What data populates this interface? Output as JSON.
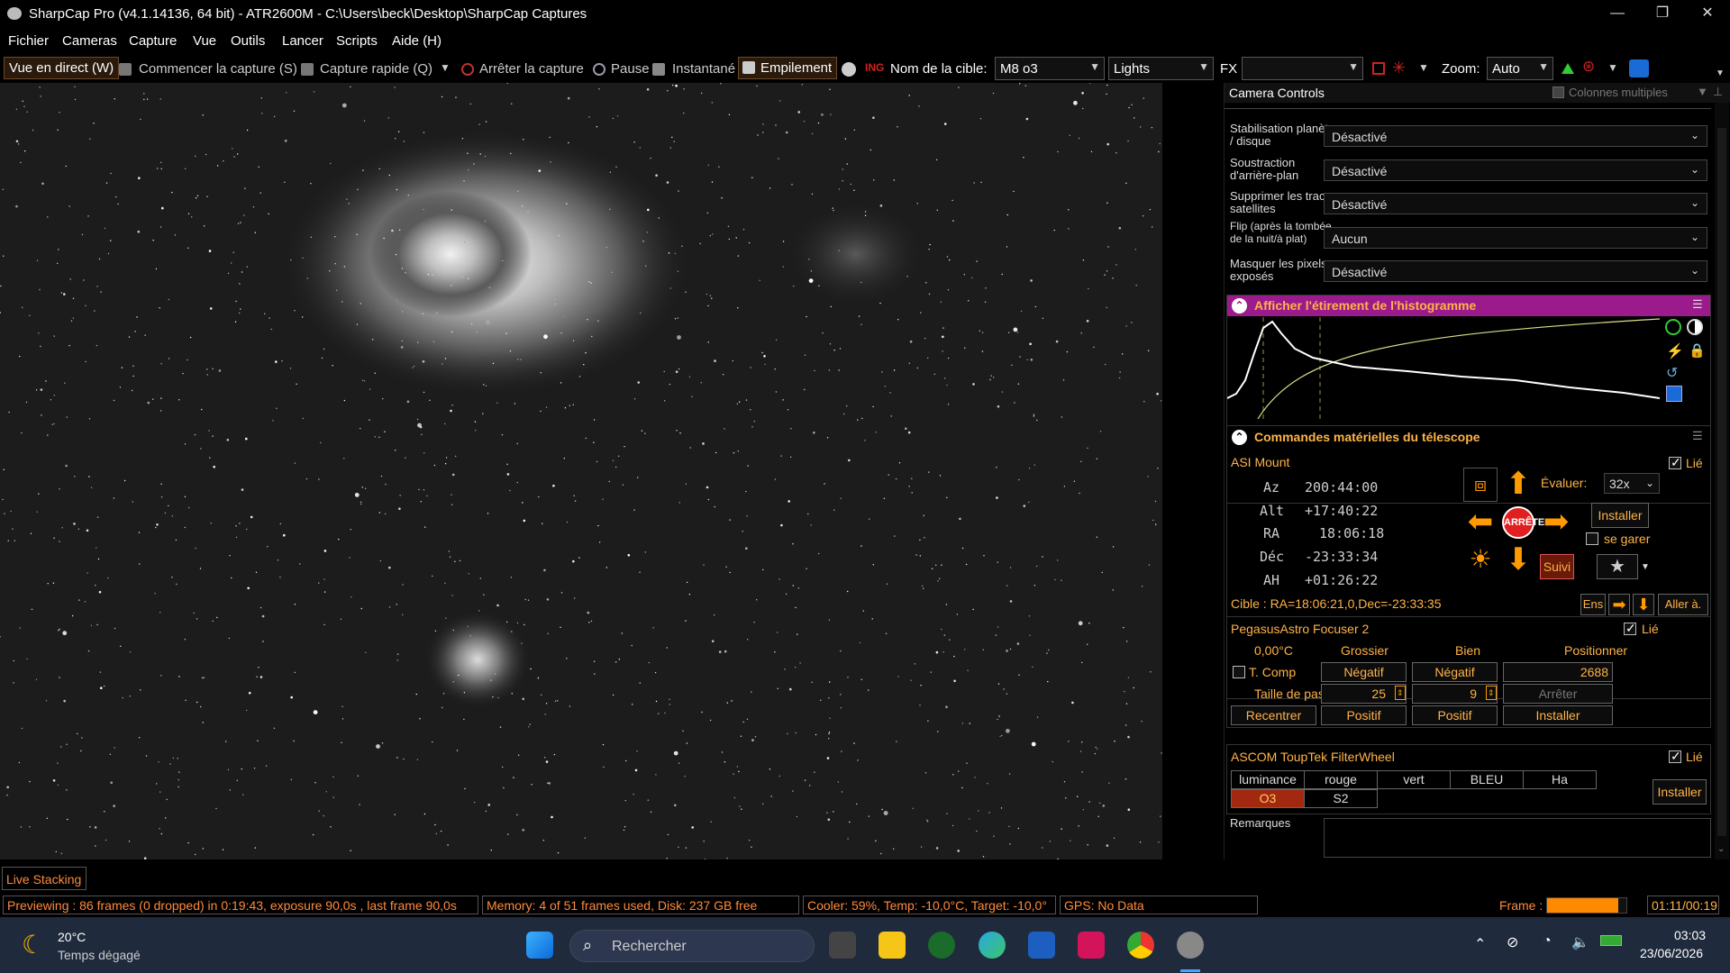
{
  "window": {
    "title": "SharpCap Pro (v4.1.14136, 64 bit) - ATR2600M - C:\\Users\\beck\\Desktop\\SharpCap Captures"
  },
  "menu": [
    "Fichier",
    "Cameras",
    "Capture",
    "Vue",
    "Outils",
    "Lancer",
    "Scripts",
    "Aide (H)"
  ],
  "toolbar": {
    "live_view": "Vue en direct (W)",
    "start_capture": "Commencer la capture (S)",
    "quick_capture": "Capture rapide (Q)",
    "stop_capture": "Arrêter la capture",
    "pause": "Pause",
    "snapshot": "Instantané",
    "stacking": "Empilement",
    "target_label": "Nom de la cible:",
    "target_value": "M8 o3",
    "frame_type": "Lights",
    "fx_label": "FX",
    "fx_value": "",
    "zoom_label": "Zoom:",
    "zoom_value": "Auto"
  },
  "panel": {
    "title": "Camera Controls",
    "multi_columns": "Colonnes multiples",
    "settings": [
      {
        "label": "Stabilisation planète / disque",
        "value": "Désactivé"
      },
      {
        "label": "Soustraction d'arrière-plan",
        "value": "Désactivé"
      },
      {
        "label": "Supprimer les traces satellites",
        "value": "Désactivé"
      },
      {
        "label": "Flip (après la tombée de la nuit/à plat)",
        "value": "Aucun"
      },
      {
        "label": "Masquer les pixels exposés",
        "value": "Désactivé"
      }
    ],
    "histogram": {
      "title": "Afficher l'étirement de l'histogramme"
    },
    "telescope": {
      "title": "Commandes matérielles du télescope",
      "mount_name": "ASI Mount",
      "linked": "Lié",
      "coords": [
        {
          "k": "Az",
          "v": "200:44:00"
        },
        {
          "k": "Alt",
          "v": "+17:40:22"
        },
        {
          "k": "RA",
          "v": "18:06:18"
        },
        {
          "k": "Déc",
          "v": "-23:33:34"
        },
        {
          "k": "AH",
          "v": "+01:26:22"
        }
      ],
      "stop": "ARRÊTE",
      "rate_label": "Évaluer:",
      "rate_value": "32x",
      "install": "Installer",
      "park": "se garer",
      "track": "Suivi",
      "target": "Cible : RA=18:06:21,0,Dec=-23:33:35",
      "set": "Ens",
      "goto": "Aller à."
    },
    "focuser": {
      "name": "PegasusAstro Focuser 2",
      "linked": "Lié",
      "temp": "0,00°C",
      "coarse": "Grossier",
      "fine": "Bien",
      "position": "Positionner",
      "tcomp": "T. Comp",
      "neg": "Négatif",
      "pos_value": "2688",
      "step_label": "Taille de pas",
      "step_coarse": "25",
      "step_fine": "9",
      "stop": "Arrêter",
      "recenter": "Recentrer",
      "positive": "Positif",
      "install": "Installer"
    },
    "filterwheel": {
      "name": "ASCOM ToupTek FilterWheel",
      "linked": "Lié",
      "filters": [
        "luminance",
        "rouge",
        "vert",
        "BLEU",
        "Ha",
        "O3",
        "S2"
      ],
      "selected": "O3",
      "install": "Installer"
    },
    "notes": "Remarques"
  },
  "live_stacking_tab": "Live Stacking",
  "status": {
    "preview": "Previewing : 86 frames (0 dropped) in 0:19:43, exposure 90,0s , last frame 90,0s",
    "memory": "Memory: 4 of 51 frames used, Disk: 237 GB free",
    "cooler": "Cooler: 59%, Temp: -10,0°C, Target: -10,0°",
    "gps": "GPS: No Data",
    "frame_label": "Frame :",
    "frame_time": "01:11/00:19",
    "frame_progress": 0.9
  },
  "taskbar": {
    "temp": "20°C",
    "weather": "Temps dégagé",
    "search": "Rechercher",
    "time": "03:03",
    "date": "23/06/2026"
  },
  "colors": {
    "accent_orange": "#ff8a00",
    "histogram_magenta": "#9b1a8c",
    "stop_red": "#e02020"
  }
}
